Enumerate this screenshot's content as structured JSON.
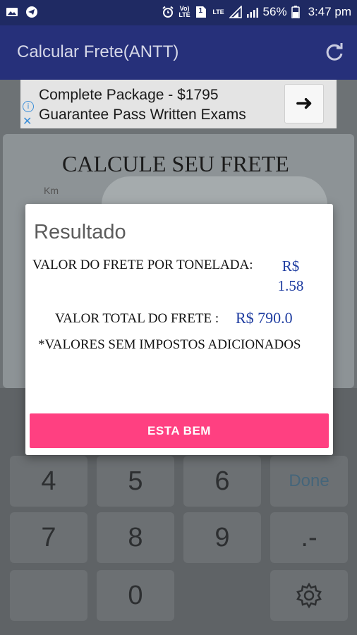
{
  "status_bar": {
    "battery_percent": "56%",
    "time": "3:47 pm",
    "left_icons": [
      "image-icon",
      "telegram-icon"
    ],
    "right_icons": [
      "alarm-icon",
      "volte-icon",
      "sim1-icon",
      "lte-icon",
      "signal-icon",
      "battery-icon"
    ],
    "volte_label": "Vo) LTE",
    "sim_label": "1",
    "lte_label": "LTE"
  },
  "app_bar": {
    "title": "Calcular Frete(ANTT)",
    "action_icon": "refresh-icon"
  },
  "ad": {
    "line1": "Complete Package - $1795",
    "line2": "Guarantee Pass Written Exams",
    "info_glyph": "i",
    "close_glyph": "✕",
    "arrow_glyph": "➜"
  },
  "calculator": {
    "title": "CALCULE SEU FRETE",
    "km_label": "Km"
  },
  "dialog": {
    "title": "Resultado",
    "label_per_ton": "VALOR DO FRETE POR TONELADA:",
    "value_per_ton_currency": "R$",
    "value_per_ton_amount": "1.58",
    "label_total": "VALOR TOTAL DO FRETE :",
    "value_total": "R$ 790.0",
    "note": "*VALORES SEM IMPOSTOS ADICIONADOS",
    "ok_button": "ESTA BEM"
  },
  "keypad": {
    "row1": [
      "4",
      "5",
      "6",
      "Done"
    ],
    "row2": [
      "7",
      "8",
      "9",
      ".-"
    ],
    "row3": [
      "0"
    ],
    "settings_icon": "gear-icon"
  },
  "colors": {
    "status_bar": "#1f2a63",
    "app_bar": "#26307a",
    "accent_button": "#ff4081",
    "value_text": "#1e3ca0"
  }
}
